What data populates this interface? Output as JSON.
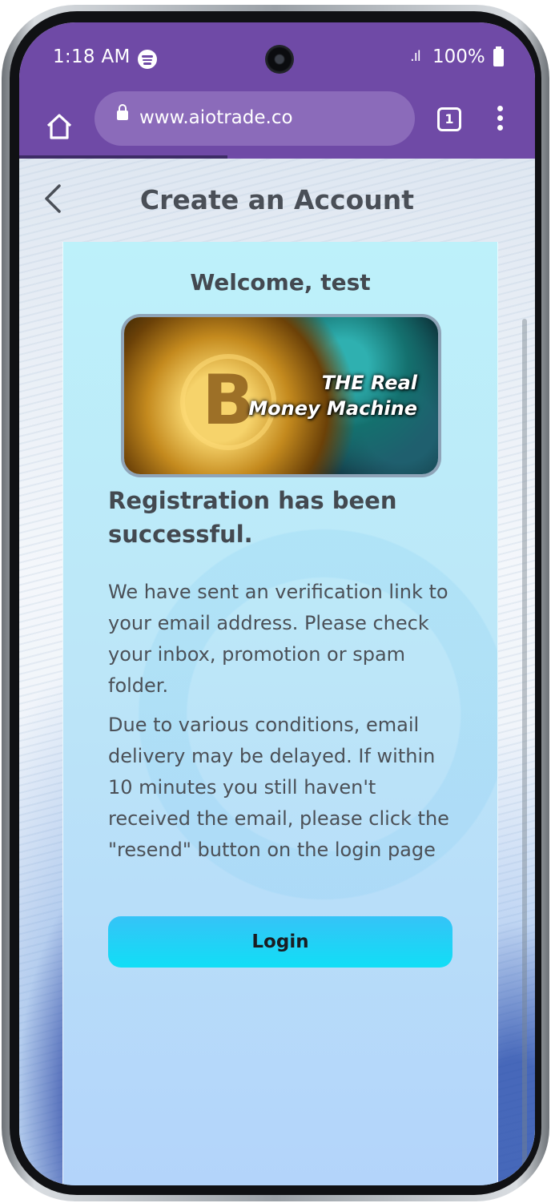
{
  "status_bar": {
    "time": "1:18 AM",
    "signal": ".ıl",
    "battery": "100%"
  },
  "browser": {
    "url": "www.aiotrade.co",
    "tab_count": "1"
  },
  "page": {
    "title": "Create an Account",
    "welcome": "Welcome, test",
    "banner_line1": "THE Real",
    "banner_line2": "Money Machine",
    "success_heading": "Registration has been successful.",
    "paragraph1": "We have sent an verification link to your email address. Please check your inbox, promotion or spam folder.",
    "paragraph2": "Due to various conditions, email delivery may be delayed. If within 10 minutes you still haven't received the email, please click the \"resend\" button on the login page",
    "login_label": "Login"
  },
  "colors": {
    "browser_bar": "#6f4aa6",
    "url_pill": "#8b6bba",
    "card_top": "#bdf1fa",
    "card_bottom": "#b3d4fa",
    "button_accent": "#11def6"
  },
  "icons": [
    "spotify-icon",
    "camera-cutout",
    "signal-icon",
    "battery-icon",
    "home-icon",
    "lock-icon",
    "tabs-icon",
    "more-vert-icon",
    "back-arrow-icon"
  ]
}
